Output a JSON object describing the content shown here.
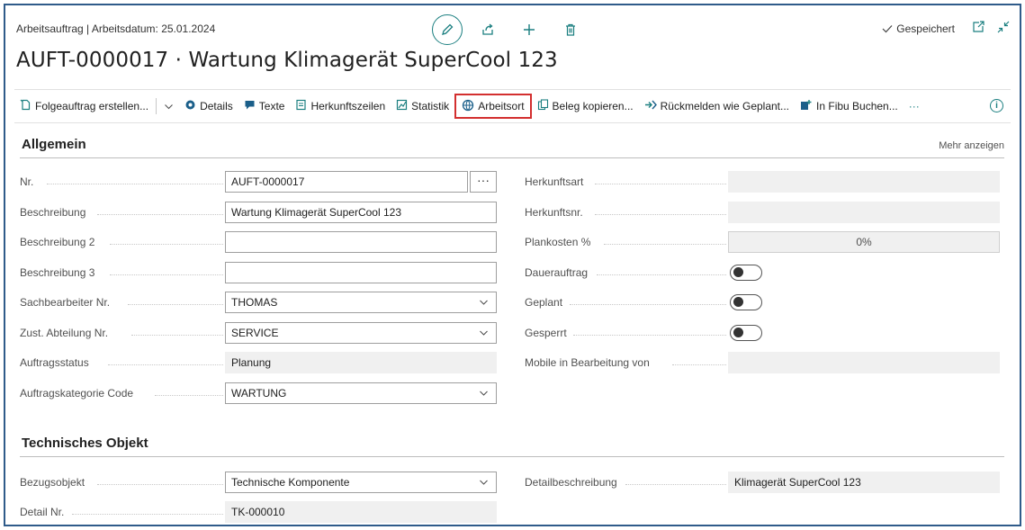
{
  "header": {
    "breadcrumb": "Arbeitsauftrag | Arbeitsdatum: 25.01.2024",
    "saved_label": "Gespeichert",
    "title": "AUFT-0000017 · Wartung Klimagerät SuperCool 123"
  },
  "actions": [
    {
      "label": "Folgeauftrag erstellen...",
      "icon": "new-doc-icon"
    },
    {
      "label": "Details",
      "icon": "details-icon"
    },
    {
      "label": "Texte",
      "icon": "text-icon"
    },
    {
      "label": "Herkunftszeilen",
      "icon": "lines-icon"
    },
    {
      "label": "Statistik",
      "icon": "statistics-icon"
    },
    {
      "label": "Arbeitsort",
      "icon": "globe-icon"
    },
    {
      "label": "Beleg kopieren...",
      "icon": "copy-icon"
    },
    {
      "label": "Rückmelden wie Geplant...",
      "icon": "report-icon"
    },
    {
      "label": "In Fibu Buchen...",
      "icon": "post-icon"
    },
    {
      "label": "···",
      "icon": "more-icon"
    }
  ],
  "general": {
    "heading": "Allgemein",
    "show_more": "Mehr anzeigen",
    "left_fields": [
      {
        "label": "Nr.",
        "value": "AUFT-0000017"
      },
      {
        "label": "Beschreibung",
        "value": "Wartung Klimagerät SuperCool 123"
      },
      {
        "label": "Beschreibung 2",
        "value": ""
      },
      {
        "label": "Beschreibung 3",
        "value": ""
      },
      {
        "label": "Sachbearbeiter Nr.",
        "value": "THOMAS"
      },
      {
        "label": "Zust. Abteilung Nr.",
        "value": "SERVICE"
      },
      {
        "label": "Auftragsstatus",
        "value": "Planung"
      },
      {
        "label": "Auftragskategorie Code",
        "value": "WARTUNG"
      }
    ],
    "right_fields": [
      {
        "label": "Herkunftsart",
        "value": ""
      },
      {
        "label": "Herkunftsnr.",
        "value": ""
      },
      {
        "label": "Plankosten %",
        "value": "0%"
      },
      {
        "label": "Dauerauftrag",
        "value": "off"
      },
      {
        "label": "Geplant",
        "value": "off"
      },
      {
        "label": "Gesperrt",
        "value": "off"
      },
      {
        "label": "Mobile in Bearbeitung von",
        "value": ""
      }
    ]
  },
  "technical": {
    "heading": "Technisches Objekt",
    "left_fields": [
      {
        "label": "Bezugsobjekt",
        "value": "Technische Komponente"
      },
      {
        "label": "Detail Nr.",
        "value": "TK-000010"
      }
    ],
    "right_fields": [
      {
        "label": "Detailbeschreibung",
        "value": "Klimagerät SuperCool 123"
      }
    ]
  }
}
